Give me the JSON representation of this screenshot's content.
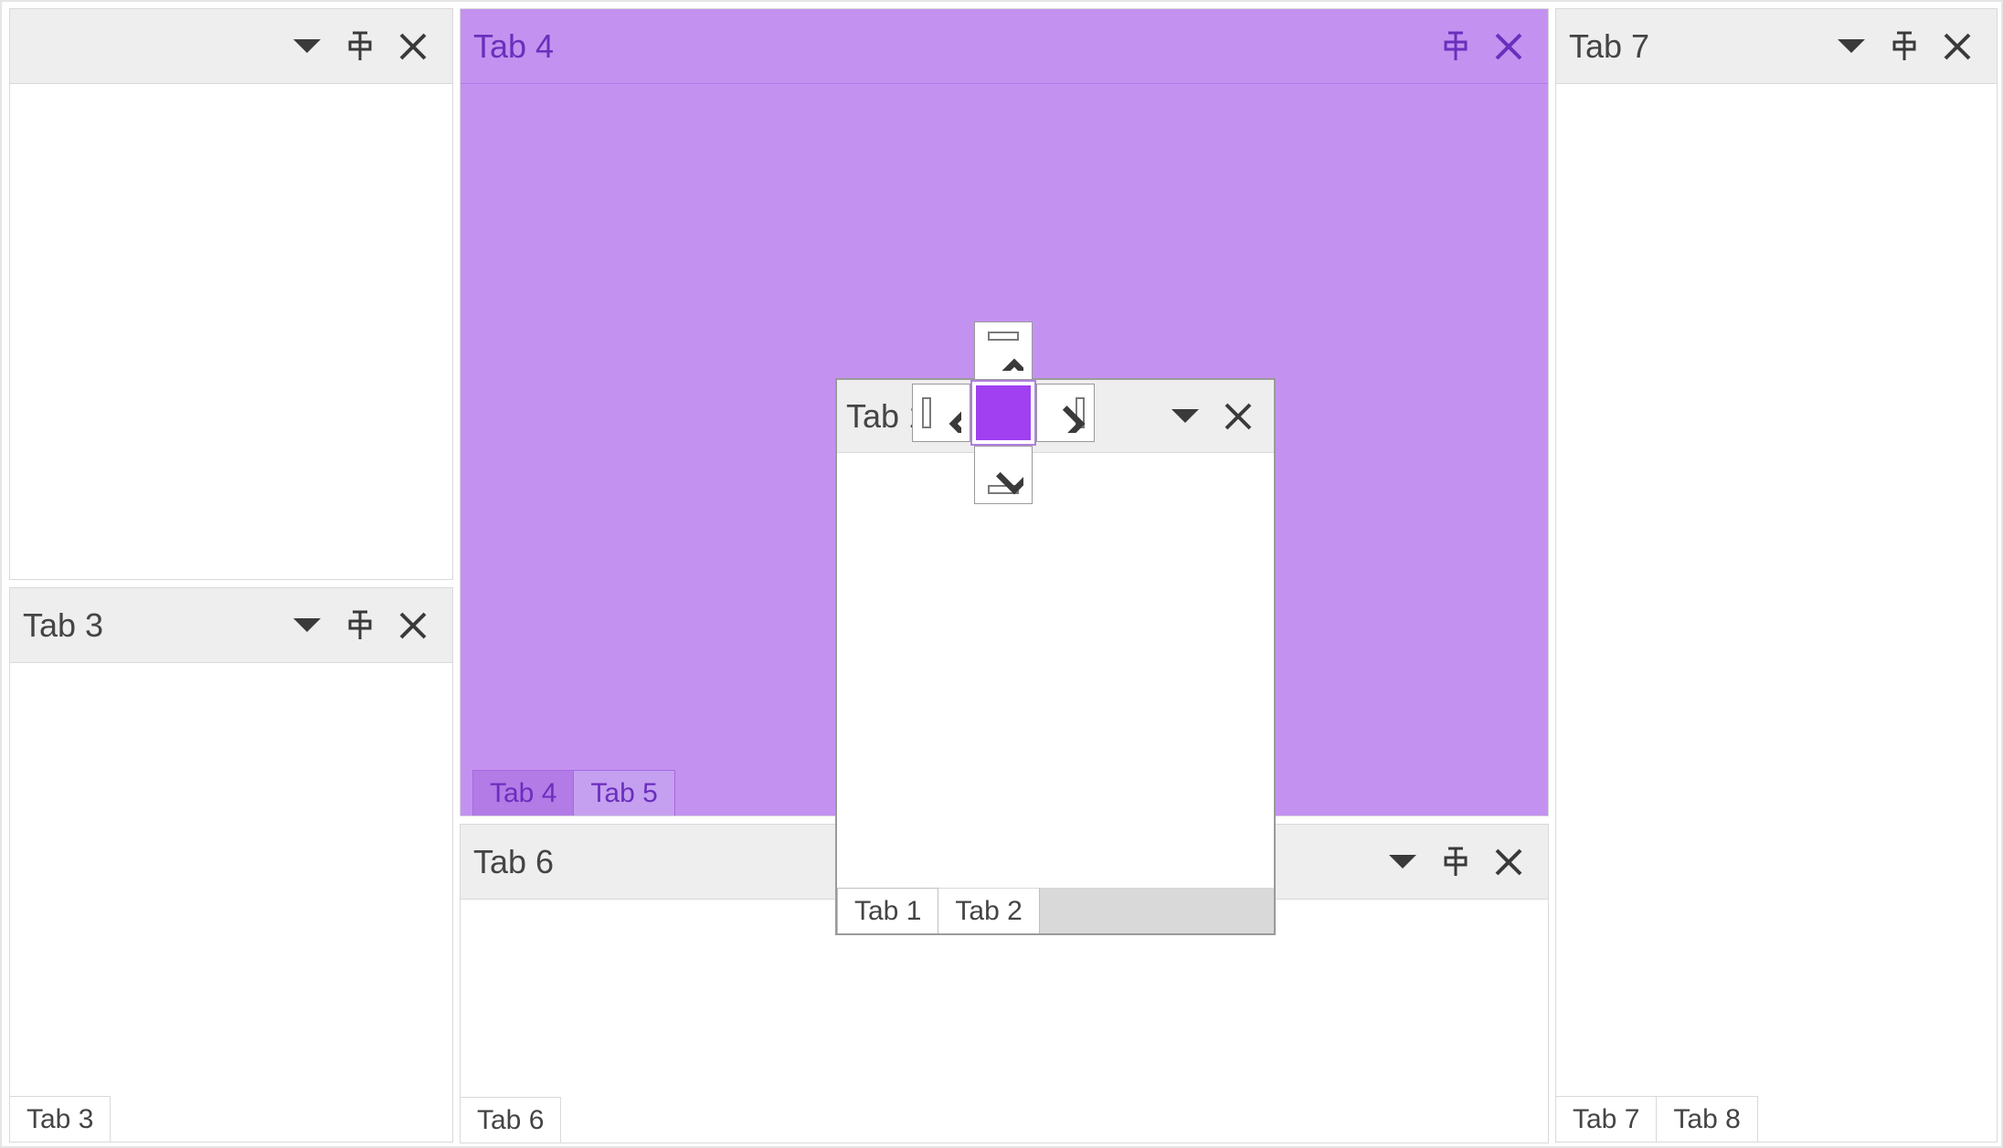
{
  "left_top": {
    "title": "",
    "has_dropdown": true,
    "has_pin": true,
    "has_close": true
  },
  "left_bottom": {
    "title": "Tab 3",
    "footer_tabs": [
      "Tab 3"
    ]
  },
  "center_top": {
    "title": "Tab 4",
    "footer_tabs": [
      "Tab 4",
      "Tab 5"
    ],
    "active_footer": 0
  },
  "center_bottom": {
    "title": "Tab 6",
    "footer_tabs": [
      "Tab 6"
    ]
  },
  "right": {
    "title": "Tab 7",
    "footer_tabs": [
      "Tab 7",
      "Tab 8"
    ]
  },
  "floating": {
    "title": "Tab 1",
    "footer_tabs": [
      "Tab 1",
      "Tab 2"
    ]
  }
}
